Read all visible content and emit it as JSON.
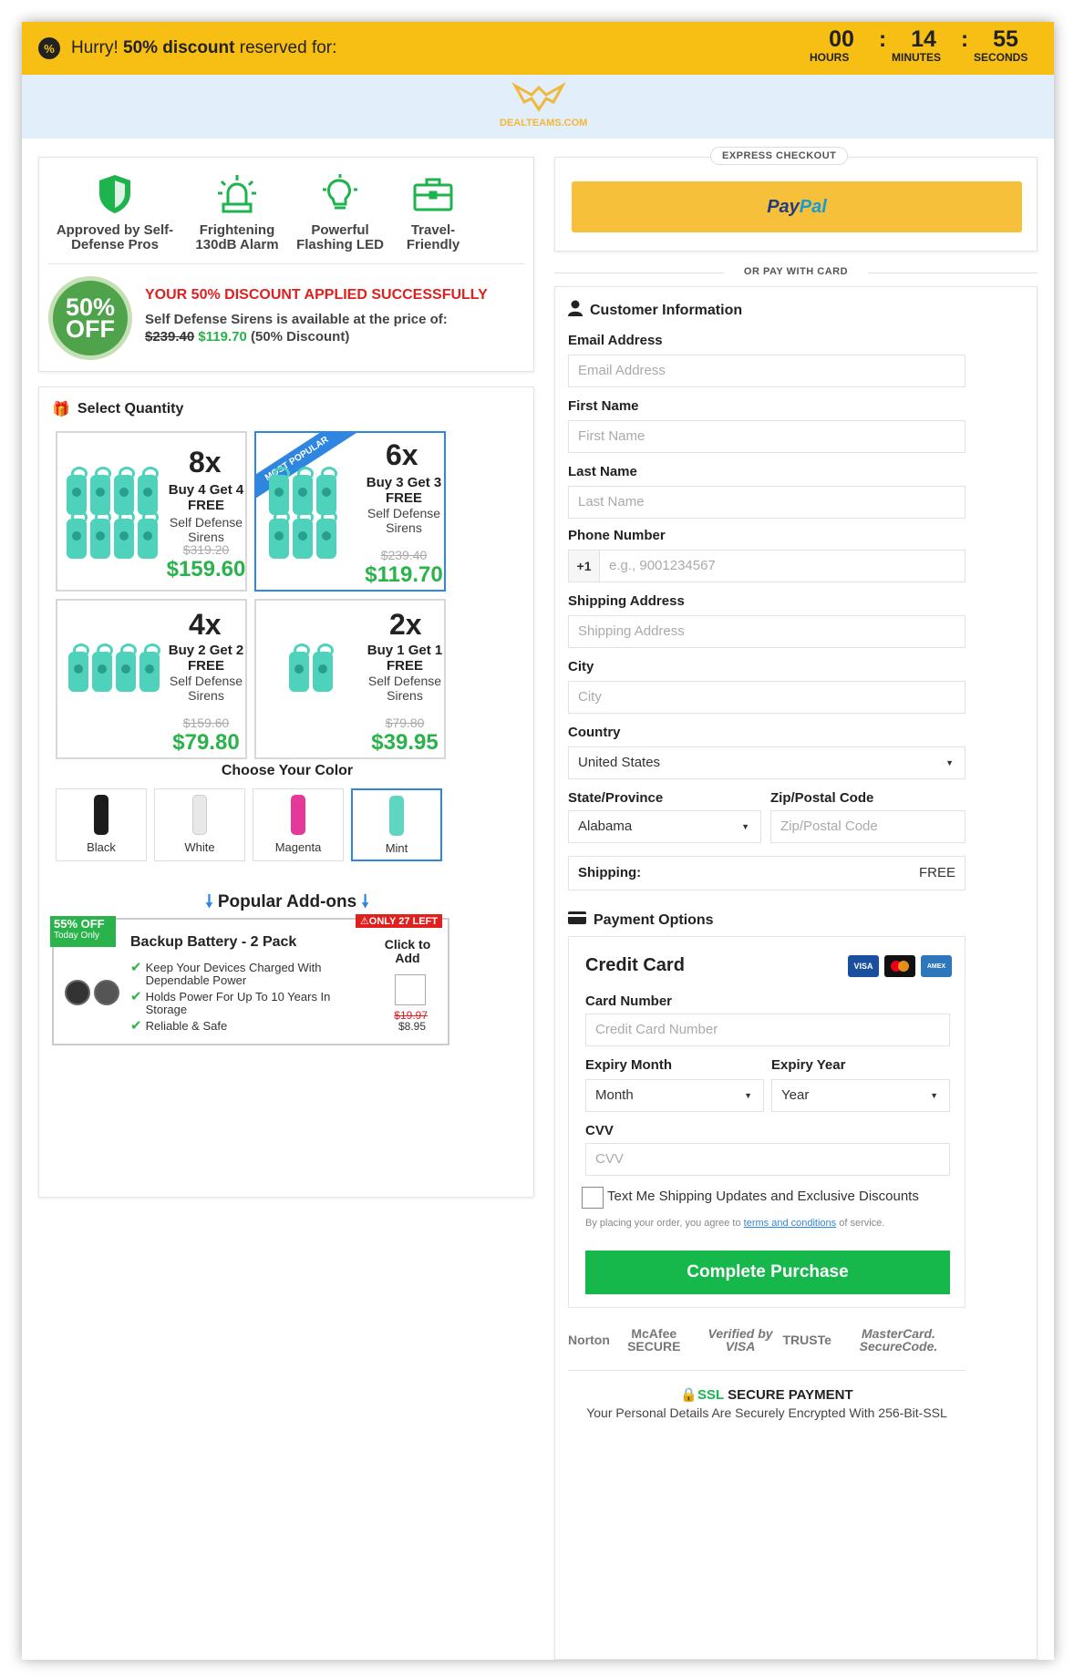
{
  "topbar": {
    "prefix": "Hurry! ",
    "bold": "50% discount",
    "suffix": " reserved for:"
  },
  "timer": {
    "hours": "00",
    "minutes": "14",
    "seconds": "55",
    "hours_label": "HOURS",
    "minutes_label": "MINUTES",
    "seconds_label": "SECONDS"
  },
  "logo": {
    "text": "DEALTEAMS.COM"
  },
  "features": [
    {
      "label": "Approved by Self-Defense Pros",
      "icon": "shield-icon"
    },
    {
      "label": "Frightening 130dB Alarm",
      "icon": "siren-alarm-icon"
    },
    {
      "label": "Powerful Flashing LED",
      "icon": "light-bulb-icon"
    },
    {
      "label": "Travel-Friendly",
      "icon": "briefcase-icon"
    }
  ],
  "discount": {
    "badge_top": "50%",
    "badge_bottom": "OFF",
    "title": "YOUR 50% DISCOUNT APPLIED SUCCESSFULLY",
    "line1": "Self Defense Sirens is available at the price of:",
    "old_price": "$239.40",
    "new_price": "$119.70",
    "note": "(50% Discount)"
  },
  "quantity": {
    "title": "Select Quantity",
    "options": [
      {
        "mult": "8x",
        "deal": "Buy 4 Get 4 FREE",
        "desc": "Self Defense Sirens",
        "orig": "$319.20",
        "price": "$159.60"
      },
      {
        "mult": "6x",
        "deal": "Buy 3 Get 3 FREE",
        "desc": "Self Defense Sirens",
        "orig": "$239.40",
        "price": "$119.70",
        "ribbon": "MOST POPULAR"
      },
      {
        "mult": "4x",
        "deal": "Buy 2 Get 2 FREE",
        "desc": "Self Defense Sirens",
        "orig": "$159.60",
        "price": "$79.80"
      },
      {
        "mult": "2x",
        "deal": "Buy 1 Get 1 FREE",
        "desc": "Self Defense Sirens",
        "orig": "$79.80",
        "price": "$39.95"
      }
    ]
  },
  "color": {
    "title": "Choose Your Color",
    "options": [
      {
        "label": "Black",
        "hex": "#1c1c1c"
      },
      {
        "label": "White",
        "hex": "#e8e8e8"
      },
      {
        "label": "Magenta",
        "hex": "#e5399a"
      },
      {
        "label": "Mint",
        "hex": "#5fd6c2"
      }
    ]
  },
  "addons": {
    "title": "Popular Add-ons",
    "off_pct": "55% OFF",
    "off_note": "Today Only",
    "stock": "ONLY 27 LEFT",
    "name": "Backup Battery - 2 Pack",
    "bullets": [
      "Keep Your Devices Charged With Dependable Power",
      "Holds Power For Up To 10 Years In Storage",
      "Reliable & Safe"
    ],
    "click": "Click to Add",
    "orig": "$19.97",
    "price": "$8.95"
  },
  "express": {
    "title": "EXPRESS CHECKOUT",
    "paypal_a": "Pay",
    "paypal_b": "Pal",
    "or": "OR PAY WITH CARD"
  },
  "customer": {
    "title": "Customer Information",
    "email_label": "Email Address",
    "email_ph": "Email Address",
    "first_label": "First Name",
    "first_ph": "First Name",
    "last_label": "Last Name",
    "last_ph": "Last Name",
    "phone_label": "Phone Number",
    "phone_prefix": "+1",
    "phone_ph": "e.g., 9001234567",
    "addr_label": "Shipping Address",
    "addr_ph": "Shipping Address",
    "city_label": "City",
    "city_ph": "City",
    "country_label": "Country",
    "country_value": "United States",
    "state_label": "State/Province",
    "state_value": "Alabama",
    "zip_label": "Zip/Postal Code",
    "zip_ph": "Zip/Postal Code",
    "shipping_label": "Shipping:",
    "shipping_value": "FREE"
  },
  "payment": {
    "title": "Payment Options",
    "cc_title": "Credit Card",
    "cards": [
      "VISA",
      "MC",
      "AMEX"
    ],
    "card_label": "Card Number",
    "card_ph": "Credit Card Number",
    "month_label": "Expiry Month",
    "month_value": "Month",
    "year_label": "Expiry Year",
    "year_value": "Year",
    "cvv_label": "CVV",
    "cvv_ph": "CVV",
    "sms_label": "Text Me Shipping Updates and Exclusive Discounts",
    "terms_pre": "By placing your order, you agree to ",
    "terms_link": "terms and conditions",
    "terms_post": " of service.",
    "button": "Complete Purchase"
  },
  "trust": [
    "Norton",
    "McAfee SECURE",
    "Verified by VISA",
    "TRUSTe",
    "MasterCard. SecureCode."
  ],
  "ssl": {
    "title_a": "SSL",
    "title_b": " SECURE PAYMENT",
    "desc": "Your Personal Details Are Securely Encrypted With 256-Bit-SSL"
  }
}
